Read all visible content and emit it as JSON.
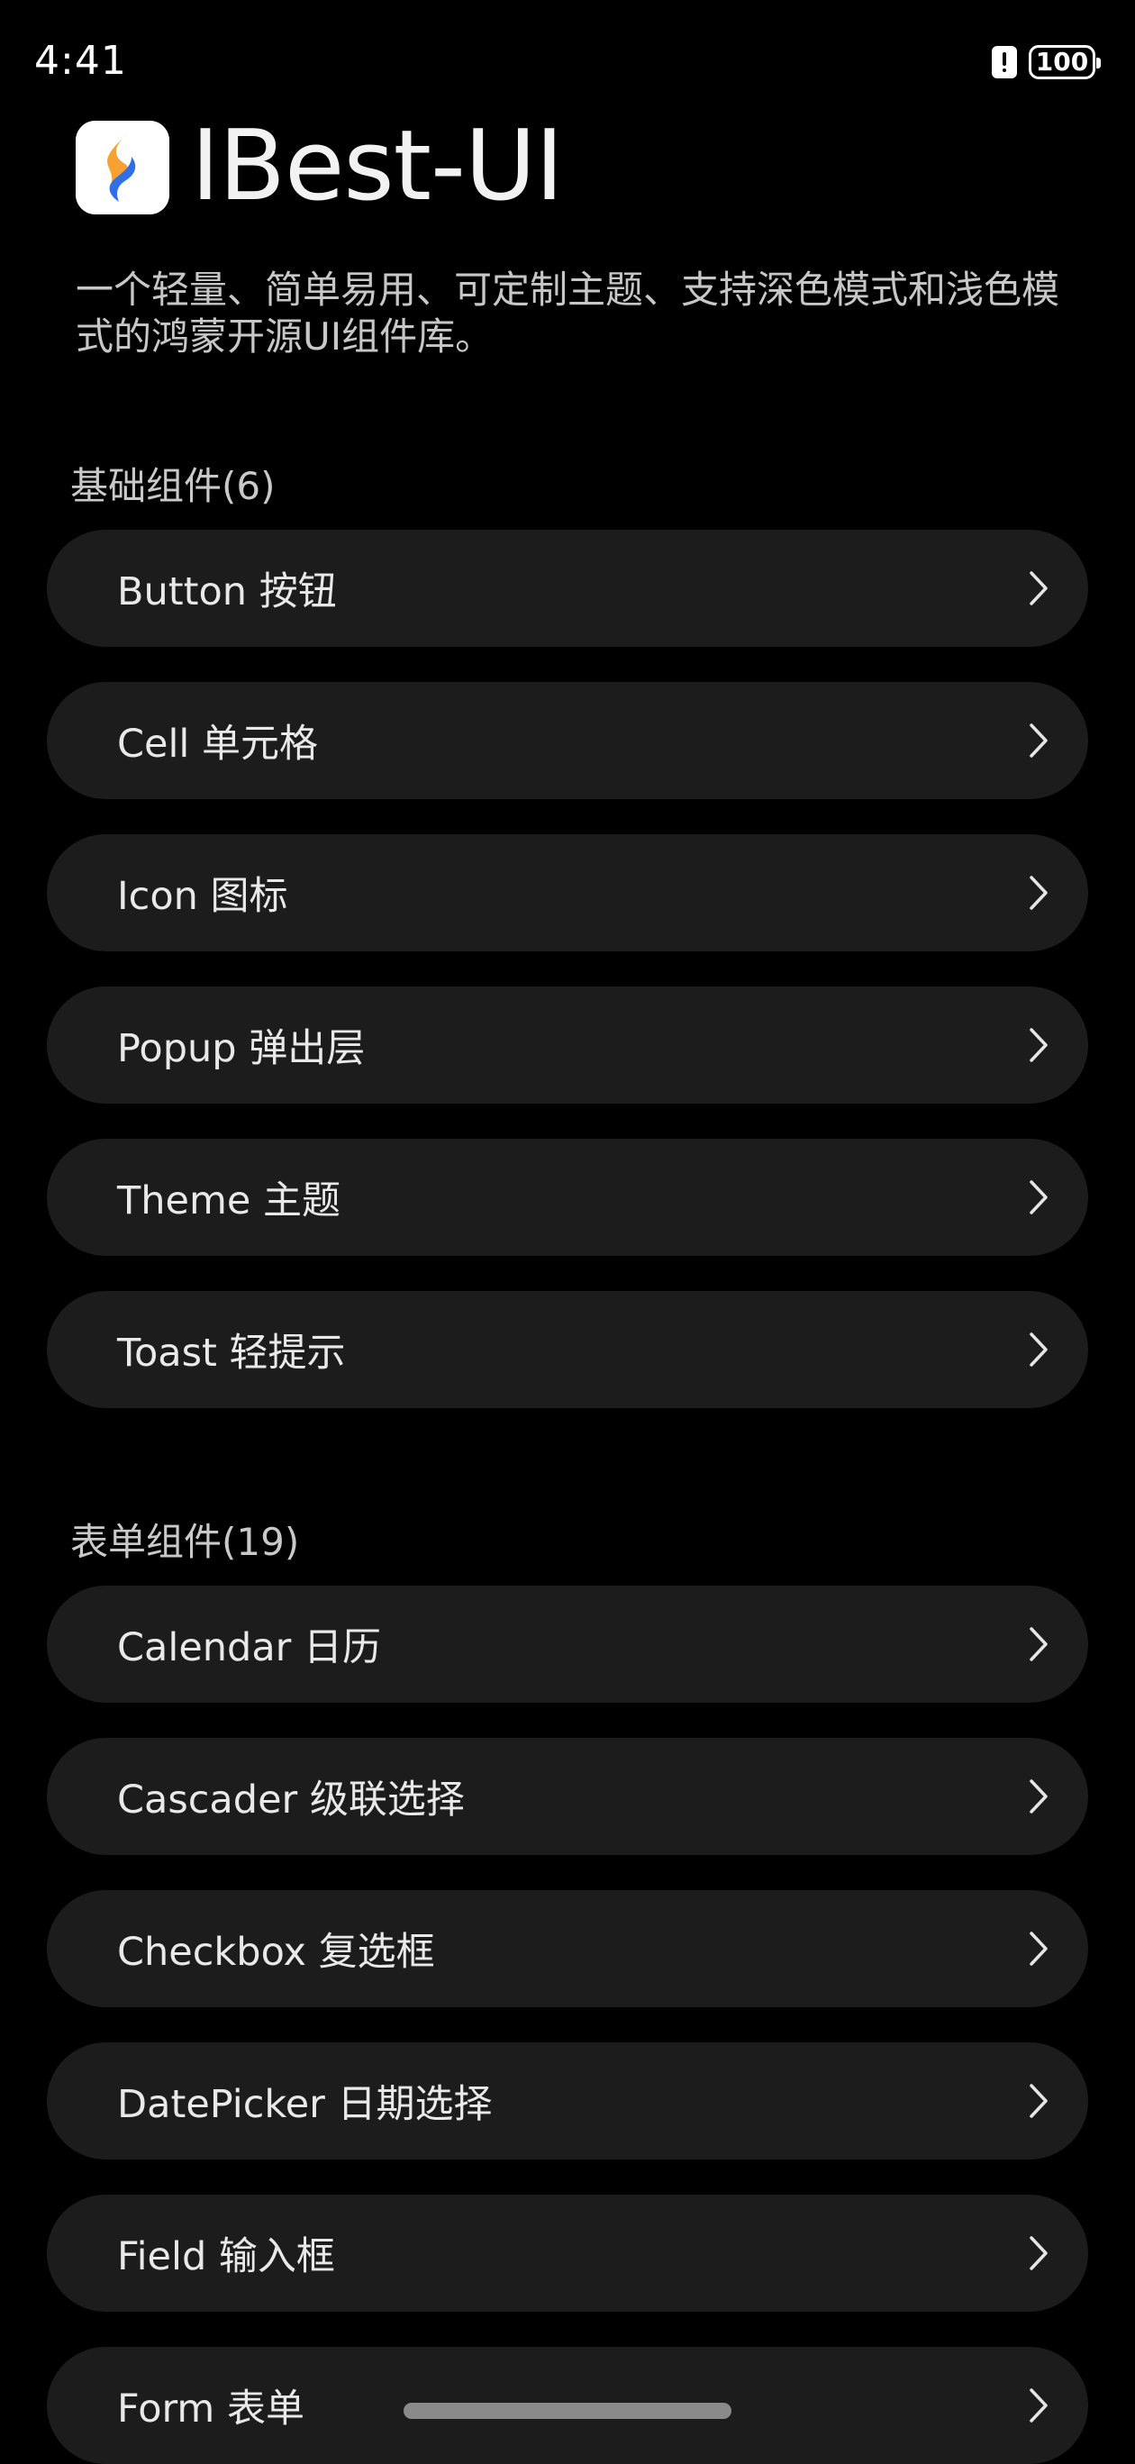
{
  "status_bar": {
    "time": "4:41",
    "battery": "100"
  },
  "header": {
    "title": "IBest-UI",
    "description": "一个轻量、简单易用、可定制主题、支持深色模式和浅色模式的鸿蒙开源UI组件库。"
  },
  "sections": [
    {
      "title": "基础组件(6)",
      "items": [
        {
          "label": "Button 按钮"
        },
        {
          "label": "Cell 单元格"
        },
        {
          "label": "Icon 图标"
        },
        {
          "label": "Popup 弹出层"
        },
        {
          "label": "Theme 主题"
        },
        {
          "label": "Toast 轻提示"
        }
      ]
    },
    {
      "title": "表单组件(19)",
      "items": [
        {
          "label": "Calendar 日历"
        },
        {
          "label": "Cascader 级联选择"
        },
        {
          "label": "Checkbox 复选框"
        },
        {
          "label": "DatePicker 日期选择"
        },
        {
          "label": "Field 输入框"
        },
        {
          "label": "Form 表单"
        }
      ]
    }
  ],
  "icons": {
    "status_alert": "alert-icon",
    "battery": "battery-icon",
    "logo": "ibest-logo-icon",
    "row_chevron": "chevron-right-icon"
  },
  "colors": {
    "background": "#000000",
    "card": "#1c1c1c",
    "text": "#e9e9e9",
    "logo_orange": "#f7a033",
    "logo_blue": "#2f6fe8"
  }
}
